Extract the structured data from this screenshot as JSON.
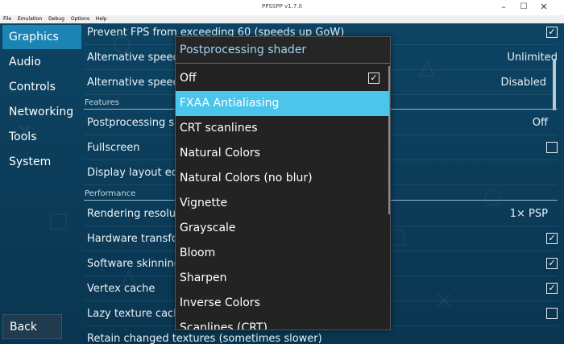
{
  "window": {
    "title": "PPSSPP v1.7.0"
  },
  "menu": [
    "File",
    "Emulation",
    "Debug",
    "Options",
    "Help"
  ],
  "sidebar": {
    "items": [
      {
        "label": "Graphics",
        "active": true
      },
      {
        "label": "Audio"
      },
      {
        "label": "Controls"
      },
      {
        "label": "Networking"
      },
      {
        "label": "Tools"
      },
      {
        "label": "System"
      }
    ],
    "back_label": "Back"
  },
  "settings": {
    "rows": [
      {
        "label": "Prevent FPS from exceeding 60 (speeds up GoW)",
        "checked": true
      },
      {
        "label": "Alternative speed",
        "value": "Unlimited"
      },
      {
        "label": "Alternative speed",
        "value": "Disabled"
      },
      {
        "header": "Features"
      },
      {
        "label": "Postprocessing s",
        "value": "Off"
      },
      {
        "label": "Fullscreen",
        "checked": false
      },
      {
        "label": "Display layout ed"
      },
      {
        "header": "Performance"
      },
      {
        "label": "Rendering resolu",
        "value": "1× PSP"
      },
      {
        "label": "Hardware transfo",
        "checked": true
      },
      {
        "label": "Software skinning",
        "checked": true
      },
      {
        "label": "Vertex cache",
        "checked": true
      },
      {
        "label": "Lazy texture cach",
        "checked": false
      },
      {
        "label": "Retain changed textures (sometimes slower)"
      }
    ]
  },
  "popup": {
    "title": "Postprocessing shader",
    "options": [
      {
        "label": "Off",
        "checked": true
      },
      {
        "label": "FXAA Antialiasing",
        "selected": true
      },
      {
        "label": "CRT scanlines"
      },
      {
        "label": "Natural Colors"
      },
      {
        "label": "Natural Colors (no blur)"
      },
      {
        "label": "Vignette"
      },
      {
        "label": "Grayscale"
      },
      {
        "label": "Bloom"
      },
      {
        "label": "Sharpen"
      },
      {
        "label": "Inverse Colors"
      },
      {
        "label": "Scanlines (CRT)"
      }
    ]
  },
  "colors": {
    "accent": "#1b84b4",
    "highlight": "#4cc5ed",
    "background": "#0b3a54",
    "popup_bg": "#232323"
  }
}
